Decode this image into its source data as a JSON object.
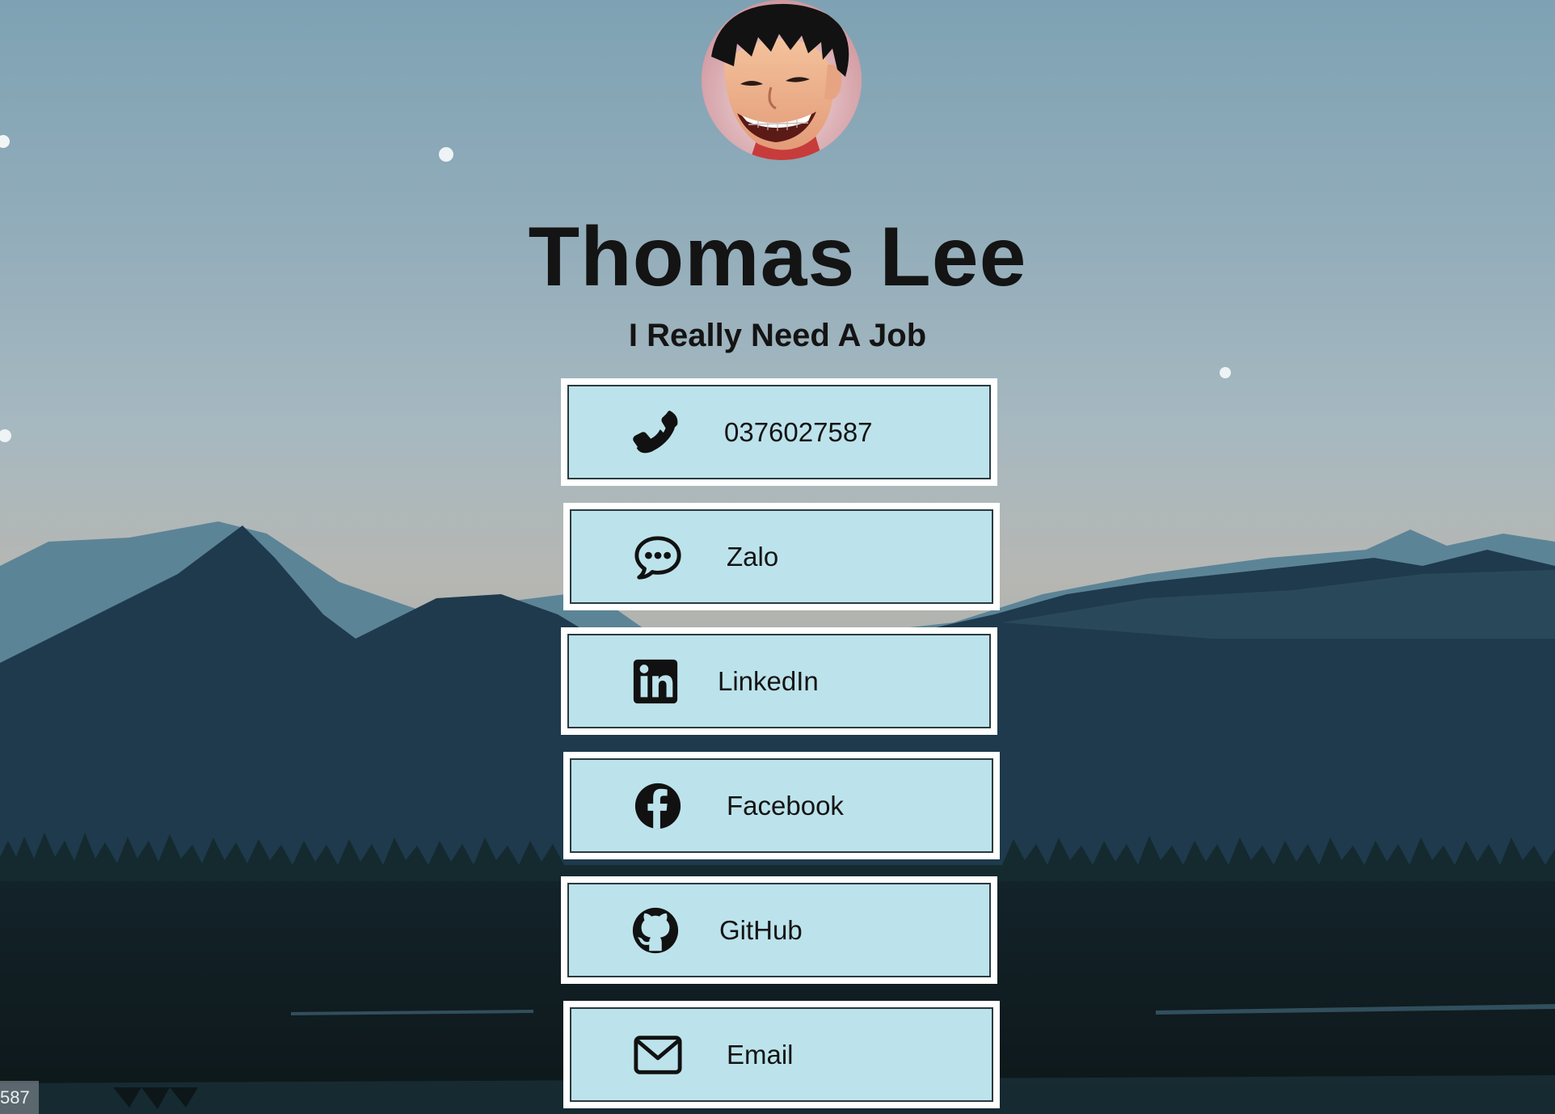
{
  "profile": {
    "name": "Thomas Lee",
    "tagline": "I Really Need A Job"
  },
  "links": [
    {
      "label": "0376027587",
      "icon": "phone-icon"
    },
    {
      "label": "Zalo",
      "icon": "chat-bubble-icon"
    },
    {
      "label": "LinkedIn",
      "icon": "linkedin-icon"
    },
    {
      "label": "Facebook",
      "icon": "facebook-icon"
    },
    {
      "label": "GitHub",
      "icon": "github-icon"
    },
    {
      "label": "Email",
      "icon": "envelope-icon"
    }
  ],
  "status_badge": "587",
  "colors": {
    "button_fill": "#bce3eb",
    "button_frame": "#ffffff",
    "text": "#141414"
  }
}
